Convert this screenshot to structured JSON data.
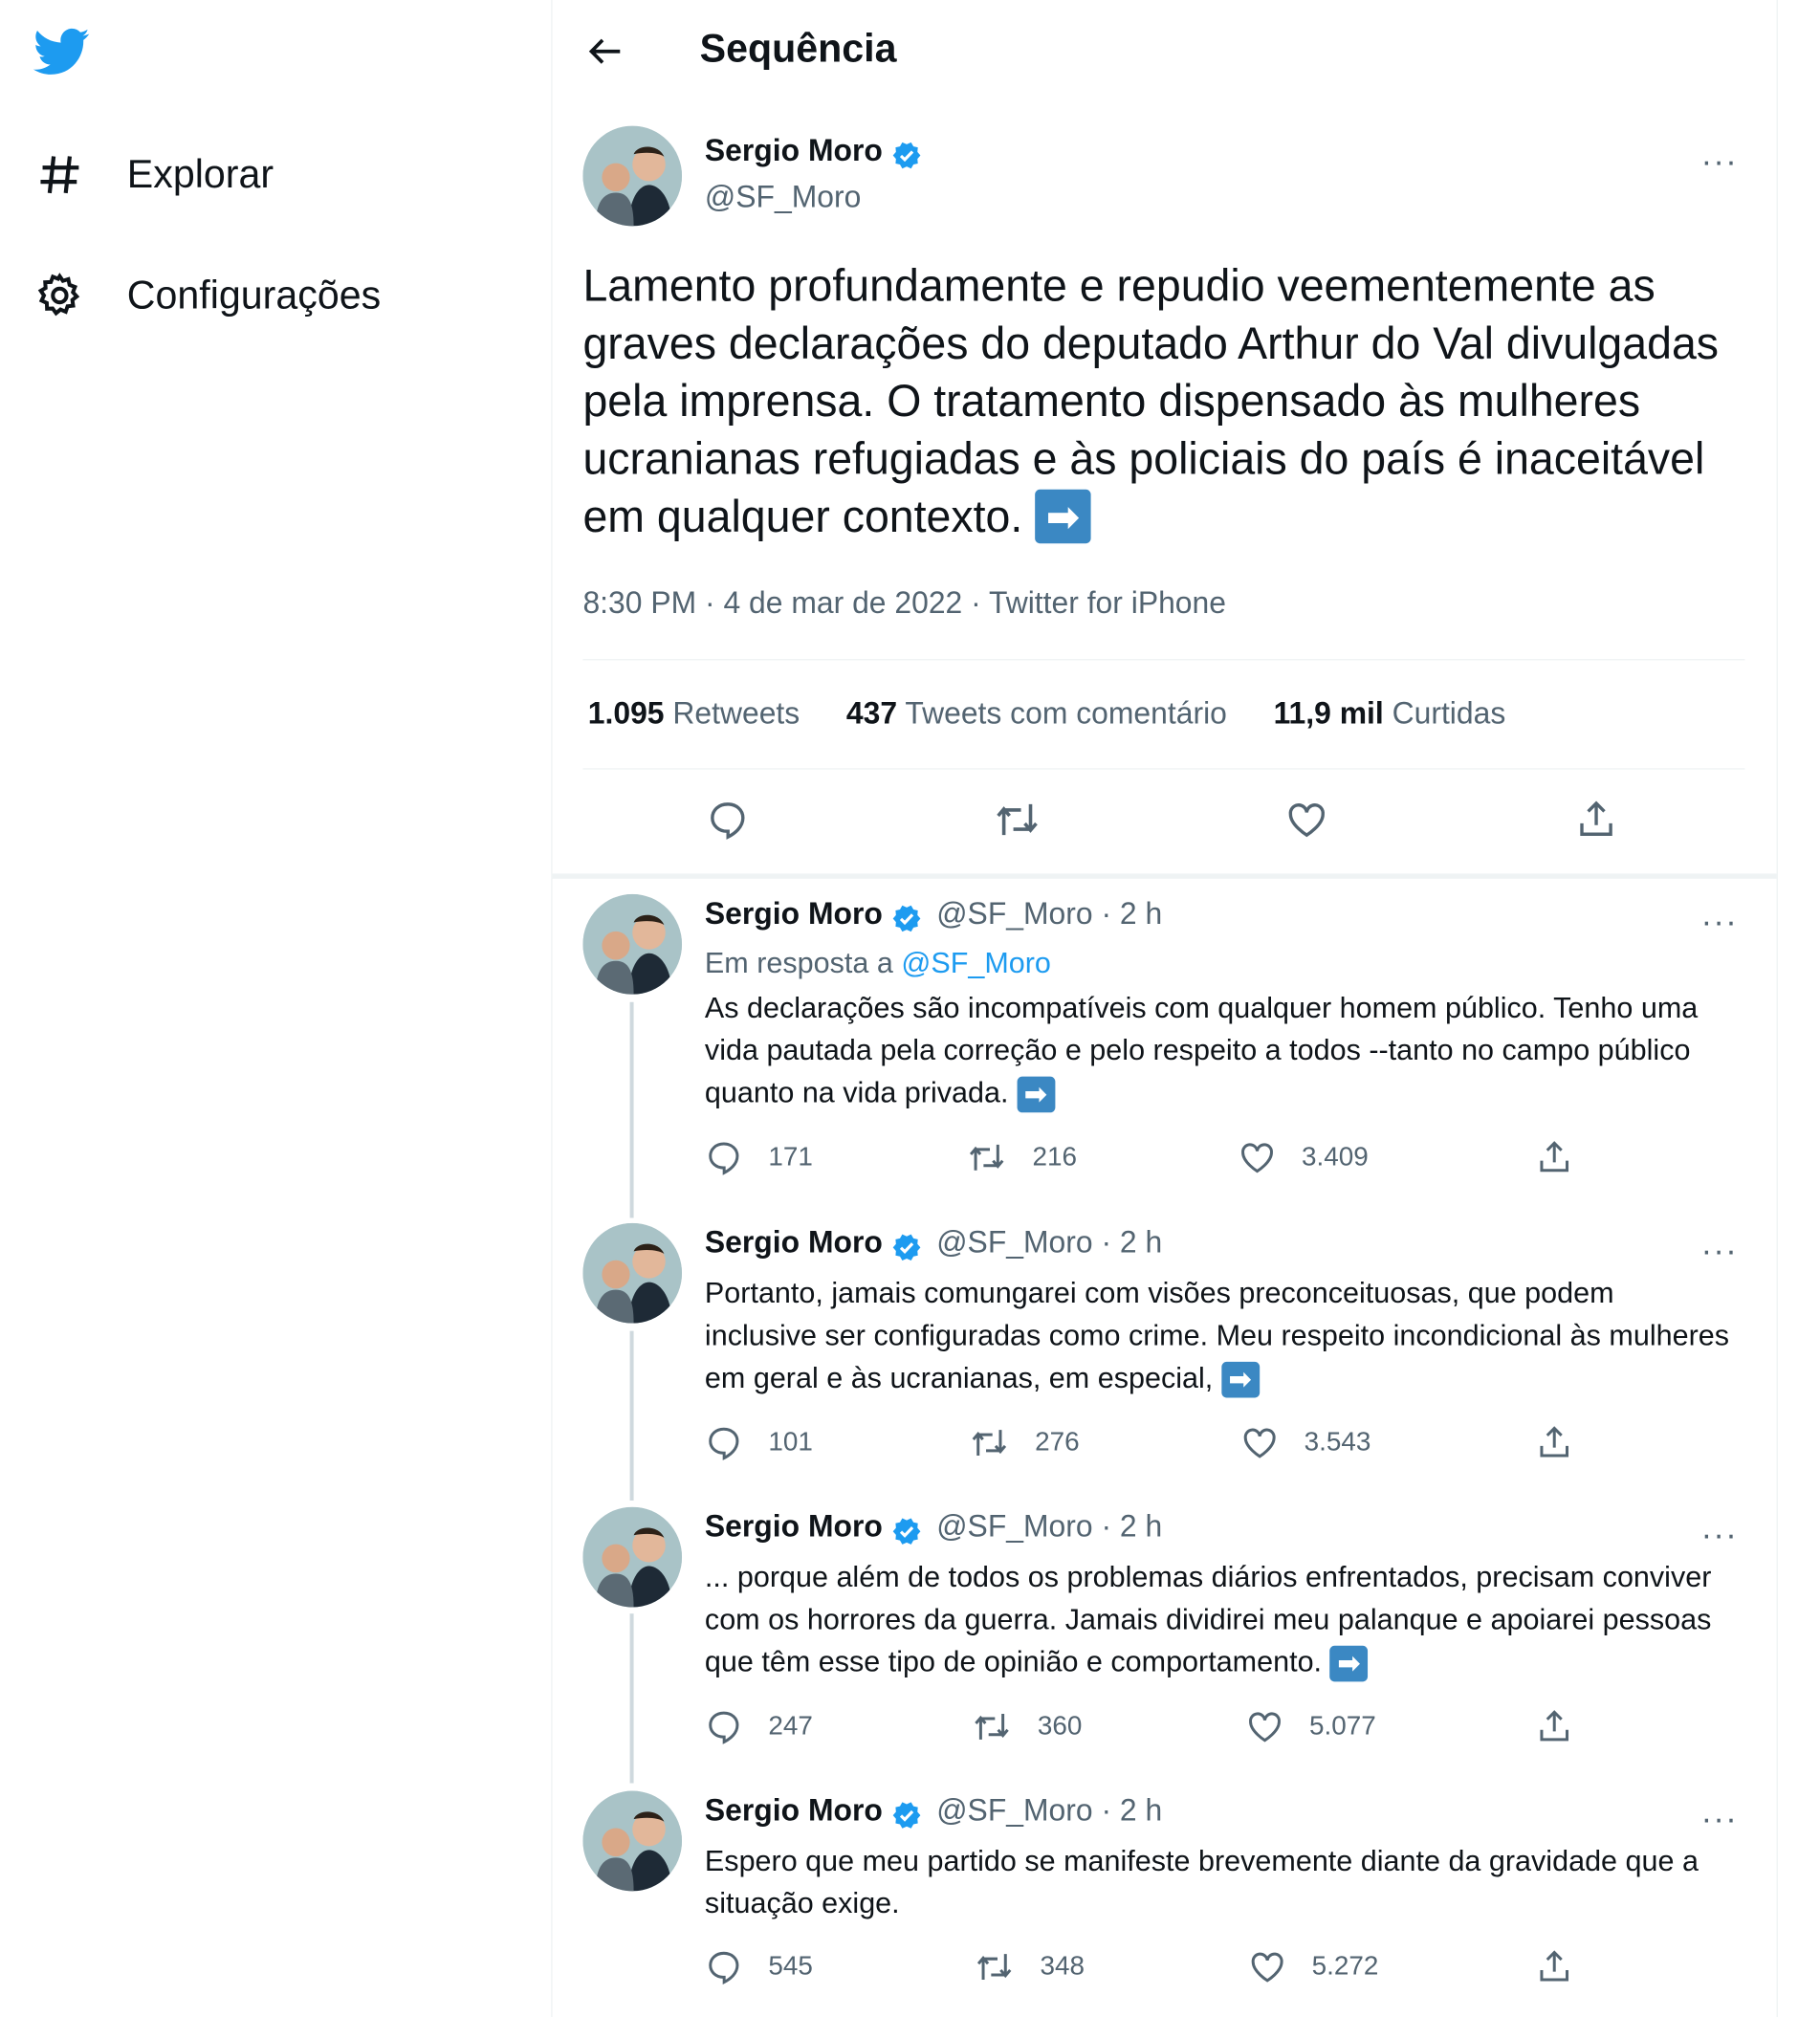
{
  "sidebar": {
    "items": [
      {
        "label": "Explorar",
        "icon": "hashtag-icon"
      },
      {
        "label": "Configurações",
        "icon": "gear-icon"
      }
    ]
  },
  "header": {
    "title": "Sequência"
  },
  "main_tweet": {
    "author_name": "Sergio Moro",
    "handle": "@SF_Moro",
    "text": "Lamento profundamente e repudio veementemente as graves declarações do deputado Arthur do Val divulgadas pela imprensa. O tratamento dispensado às mulheres ucranianas refugiadas e às policiais do país é inaceitável em qualquer contexto.",
    "arrow": "➡",
    "meta": "8:30 PM · 4 de mar de 2022 · Twitter for iPhone",
    "stats": {
      "retweets_count": "1.095",
      "retweets_label": "Retweets",
      "quotes_count": "437",
      "quotes_label": "Tweets com comentário",
      "likes_count": "11,9 mil",
      "likes_label": "Curtidas"
    }
  },
  "replies": [
    {
      "author_name": "Sergio Moro",
      "handle_time": "@SF_Moro · 2 h",
      "reply_prefix": "Em resposta a",
      "reply_to": "@SF_Moro",
      "text": "As declarações são incompatíveis com qualquer homem público. Tenho uma vida pautada pela correção e pelo respeito a todos --tanto no campo público quanto na vida privada.",
      "replies": "171",
      "retweets": "216",
      "likes": "3.409"
    },
    {
      "author_name": "Sergio Moro",
      "handle_time": "@SF_Moro · 2 h",
      "text": "Portanto, jamais comungarei com visões preconceituosas, que podem inclusive ser configuradas como crime. Meu respeito incondicional às mulheres em geral e às ucranianas, em especial,",
      "replies": "101",
      "retweets": "276",
      "likes": "3.543"
    },
    {
      "author_name": "Sergio Moro",
      "handle_time": "@SF_Moro · 2 h",
      "text": "... porque além de todos os problemas diários enfrentados, precisam conviver com os horrores da guerra. Jamais dividirei meu palanque e apoiarei  pessoas que têm esse tipo de opinião e comportamento.",
      "replies": "247",
      "retweets": "360",
      "likes": "5.077"
    },
    {
      "author_name": "Sergio Moro",
      "handle_time": "@SF_Moro · 2 h",
      "text": "Espero que meu partido se manifeste brevemente diante da gravidade que a situação exige.",
      "replies": "545",
      "retweets": "348",
      "likes": "5.272"
    }
  ],
  "colors": {
    "accent": "#1d9bf0",
    "text": "#0f1419",
    "muted": "#536471",
    "arrow_emoji": "#3b88c3"
  }
}
